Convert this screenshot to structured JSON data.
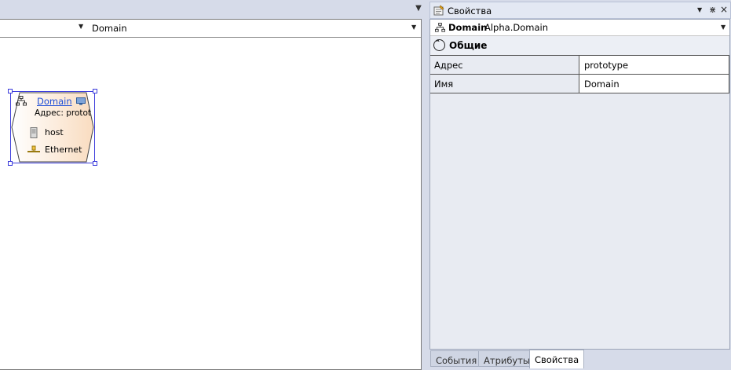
{
  "document": {
    "navigation_label": "Domain"
  },
  "diagram": {
    "node": {
      "title": "Domain",
      "address_text": "Адрес: prototype",
      "children": [
        {
          "label": "host",
          "icon": "server-icon"
        },
        {
          "label": "Ethernet",
          "icon": "ethernet-icon"
        }
      ]
    }
  },
  "properties_panel": {
    "title": "Свойства",
    "object_selector": {
      "name": "Domain",
      "type": "Alpha.Domain"
    },
    "category": {
      "label": "Общие"
    },
    "rows": [
      {
        "name": "Адрес",
        "value": "prototype"
      },
      {
        "name": "Имя",
        "value": "Domain"
      }
    ],
    "tabs": [
      {
        "label": "События",
        "active": false
      },
      {
        "label": "Атрибуты",
        "active": false
      },
      {
        "label": "Свойства",
        "active": true
      }
    ]
  },
  "colors": {
    "selection_handles": "#3c3cdc",
    "link_text": "#1f4fd8",
    "node_fill": "#fdebd8",
    "chrome_background": "#d6dbe9"
  }
}
